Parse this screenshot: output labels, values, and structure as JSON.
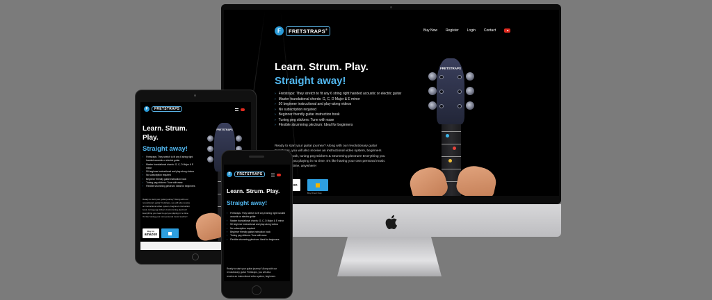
{
  "brand": {
    "logo_letter": "F",
    "name": "FRETSTRAPS",
    "registered": "®",
    "head_label": "FRETSTRAPS"
  },
  "nav": {
    "items": [
      "Buy Now",
      "Register",
      "Login",
      "Contact"
    ]
  },
  "hero": {
    "title": "Learn. Strum. Play.",
    "title_short_line1": "Learn. Strum.",
    "title_short_line2": "Play.",
    "subtitle": "Straight away!"
  },
  "features": [
    "Fretstraps: They stretch to fit any 6 string right handed acoustic or electric guitar",
    "Master foundational chords: G, C, D Major & E minor",
    "50 beginner instructional and play-along videos",
    "No subscription required",
    "Beginner friendly guitar instruction book",
    "Tuning peg stickers: Tune with ease",
    "Flexible strumming plectrum: Ideal for beginners"
  ],
  "intro_paragraph": {
    "line1": "Ready to start your guitar journey? Along with our revolutionary guitar",
    "line2": "Fretstraps, you will also receive an instructional video system, beginners",
    "line3": "instruction book, tuning peg stickers & strumming plectrum! Everything you",
    "line4": "need to get you playing in no time. It's like having your own personal music",
    "line5": "teacher, anytime, anywhere!"
  },
  "phone_paragraph": {
    "line1": "Ready to start your guitar journey? Along with our",
    "line2": "revolutionary guitar Fretstraps, you will also",
    "line3": "receive an instructional video system, beginners"
  },
  "tablet_paragraph": {
    "line1": "Ready to start your guitar journey? Along with our",
    "line2": "revolutionary guitar Fretstraps, you will also receive",
    "line3": "an instructional video system, beginners instruction",
    "line4": "book, tuning peg stickers & strumming plectrum!",
    "line5": "Everything you need to get you playing in no time.",
    "line6": "It's like having your own personal music teacher!"
  },
  "cta": {
    "amazon_small": "Buy on",
    "amazon_label": "amazon",
    "amazon_short": "on",
    "buy_small": "Buy Direct Now"
  },
  "colors": {
    "accent": "#52b8f0",
    "youtube": "#e02b20",
    "background": "#7b7b7b"
  },
  "icons": {
    "apple": "apple-logo-icon",
    "youtube": "youtube-icon",
    "bullet": "chevron-bullet-icon"
  }
}
